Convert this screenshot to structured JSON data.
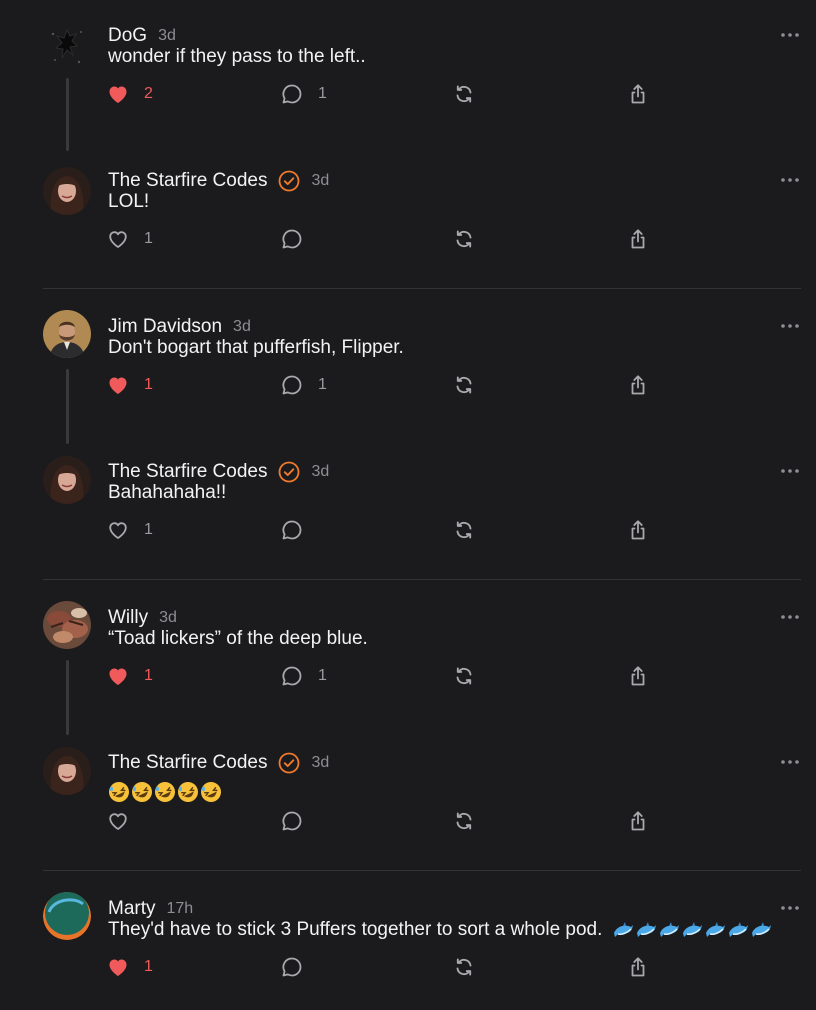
{
  "feed": {
    "posts": [
      {
        "author": "DoG",
        "time": "3d",
        "verified": false,
        "text": "wonder if they pass to the left..",
        "likes": "2",
        "liked": true,
        "replies": "1"
      },
      {
        "author": "The Starfire Codes",
        "time": "3d",
        "verified": true,
        "text": "LOL!",
        "likes": "1",
        "liked": false,
        "replies": ""
      },
      {
        "author": "Jim Davidson",
        "time": "3d",
        "verified": false,
        "text": "Don't bogart that pufferfish, Flipper.",
        "likes": "1",
        "liked": true,
        "replies": "1"
      },
      {
        "author": "The Starfire Codes",
        "time": "3d",
        "verified": true,
        "text": "Bahahahaha!!",
        "likes": "1",
        "liked": false,
        "replies": ""
      },
      {
        "author": "Willy",
        "time": "3d",
        "verified": false,
        "text": "“Toad lickers” of the deep blue.",
        "likes": "1",
        "liked": true,
        "replies": "1"
      },
      {
        "author": "The Starfire Codes",
        "time": "3d",
        "verified": true,
        "text": "",
        "emoji": "rolling-on-floor-laughing x5",
        "likes": "",
        "liked": false,
        "replies": ""
      },
      {
        "author": "Marty",
        "time": "17h",
        "verified": false,
        "text": "They'd have to stick 3 Puffers together to sort a whole pod.",
        "emoji": "dolphin x7",
        "likes": "1",
        "liked": true,
        "replies": ""
      }
    ]
  },
  "icons": {
    "like": "heart-icon",
    "reply": "comment-icon",
    "repost": "repost-icon",
    "share": "share-icon",
    "more": "more-icon",
    "verified": "verified-badge-icon"
  },
  "colors": {
    "background": "#1b1b1d",
    "liked": "#f05a5a",
    "verified": "#f07a2c",
    "muted": "#8e8e93",
    "divider": "#333336"
  }
}
